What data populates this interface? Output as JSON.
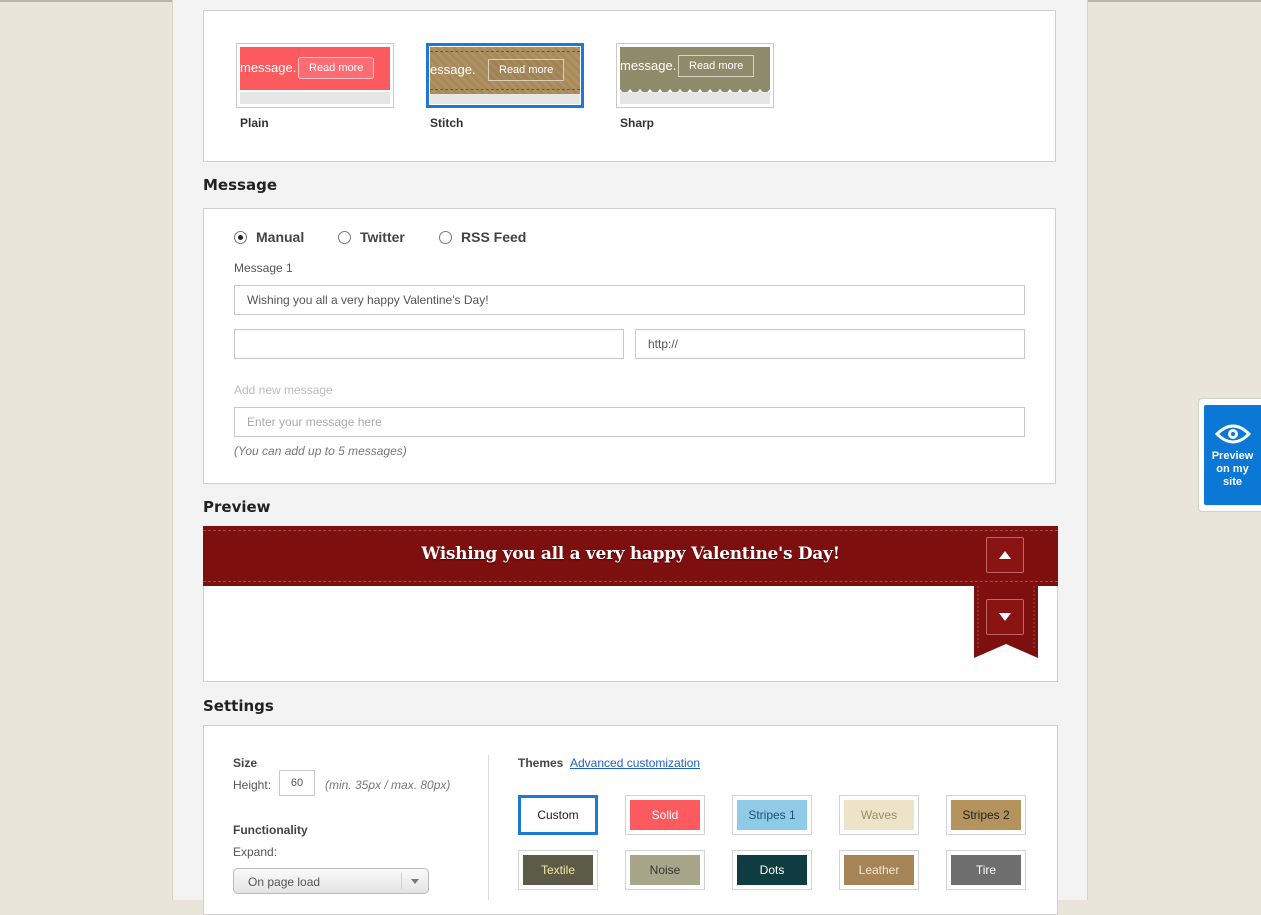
{
  "bar_styles": [
    {
      "label": "Plain",
      "msg": "message.",
      "btn": "Read more",
      "color": "#fb5a5f"
    },
    {
      "label": "Stitch",
      "msg": "essage.",
      "btn": "Read more",
      "color": "#a88a5a"
    },
    {
      "label": "Sharp",
      "msg": "message.",
      "btn": "Read more",
      "color": "#8e8a6a"
    }
  ],
  "message": {
    "title": "Message",
    "sources": [
      "Manual",
      "Twitter",
      "RSS Feed"
    ],
    "selected_source": "Manual",
    "msg1_label": "Message 1",
    "msg1_value": "Wishing you all a very happy Valentine's Day!",
    "link_text_value": "",
    "link_url_value": "http://",
    "add_label": "Add new message",
    "add_placeholder": "Enter your message here",
    "hint": "(You can add up to 5 messages)"
  },
  "preview": {
    "title": "Preview",
    "text": "Wishing you all a very happy Valentine's Day!",
    "bar_color": "#7e0f0f"
  },
  "settings": {
    "title": "Settings",
    "size_label": "Size",
    "height_label": "Height:",
    "height_value": "60",
    "height_hint": "(min. 35px / max. 80px)",
    "func_label": "Functionality",
    "expand_label": "Expand:",
    "expand_value": "On page load",
    "themes_label": "Themes",
    "advanced_link": "Advanced customization",
    "themes": [
      {
        "name": "Custom",
        "bg": "#ffffff",
        "fg": "#222222"
      },
      {
        "name": "Solid",
        "bg": "#fb5a5f",
        "fg": "#ffffff"
      },
      {
        "name": "Stripes 1",
        "bg": "#8fcbe6",
        "fg": "#1f4f86"
      },
      {
        "name": "Waves",
        "bg": "#ece3c8",
        "fg": "#9a8e6a"
      },
      {
        "name": "Stripes 2",
        "bg": "#b4945c",
        "fg": "#222222"
      },
      {
        "name": "Textile",
        "bg": "#5c5b48",
        "fg": "#f4e8a0"
      },
      {
        "name": "Noise",
        "bg": "#a8a68a",
        "fg": "#333333"
      },
      {
        "name": "Dots",
        "bg": "#0f3c40",
        "fg": "#ffffff"
      },
      {
        "name": "Leather",
        "bg": "#a78458",
        "fg": "#f2e6d2"
      },
      {
        "name": "Tire",
        "bg": "#6e6e6e",
        "fg": "#ffffff"
      }
    ]
  },
  "side_tab": {
    "label_1": "Preview",
    "label_2": "on my",
    "label_3": "site"
  }
}
